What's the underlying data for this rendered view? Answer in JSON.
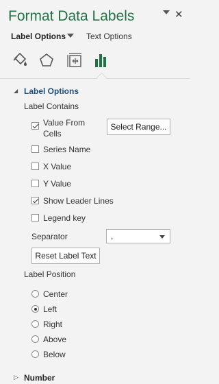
{
  "header": {
    "title": "Format Data Labels",
    "close_glyph": "✕"
  },
  "tabs": {
    "label_options": "Label Options",
    "text_options": "Text Options"
  },
  "icons": [
    "fill-line-icon",
    "effects-icon",
    "size-properties-icon",
    "label-options-icon"
  ],
  "section": {
    "title": "Label Options",
    "label_contains": "Label Contains",
    "checkboxes": [
      {
        "label": "Value From\nCells",
        "checked": true
      },
      {
        "label": "Series Name",
        "checked": false
      },
      {
        "label": "X Value",
        "checked": false
      },
      {
        "label": "Y Value",
        "checked": false
      },
      {
        "label": "Show Leader Lines",
        "checked": true
      },
      {
        "label": "Legend key",
        "checked": false
      }
    ],
    "select_range_button": "Select Range...",
    "separator_label": "Separator",
    "separator_value": ",",
    "reset_button": "Reset Label Text",
    "label_position": "Label Position",
    "radios": [
      {
        "label": "Center",
        "checked": false
      },
      {
        "label": "Left",
        "checked": true
      },
      {
        "label": "Right",
        "checked": false
      },
      {
        "label": "Above",
        "checked": false
      },
      {
        "label": "Below",
        "checked": false
      }
    ]
  },
  "number_section": {
    "title": "Number"
  },
  "colors": {
    "accent": "#217346",
    "section_header": "#1f4e79"
  }
}
